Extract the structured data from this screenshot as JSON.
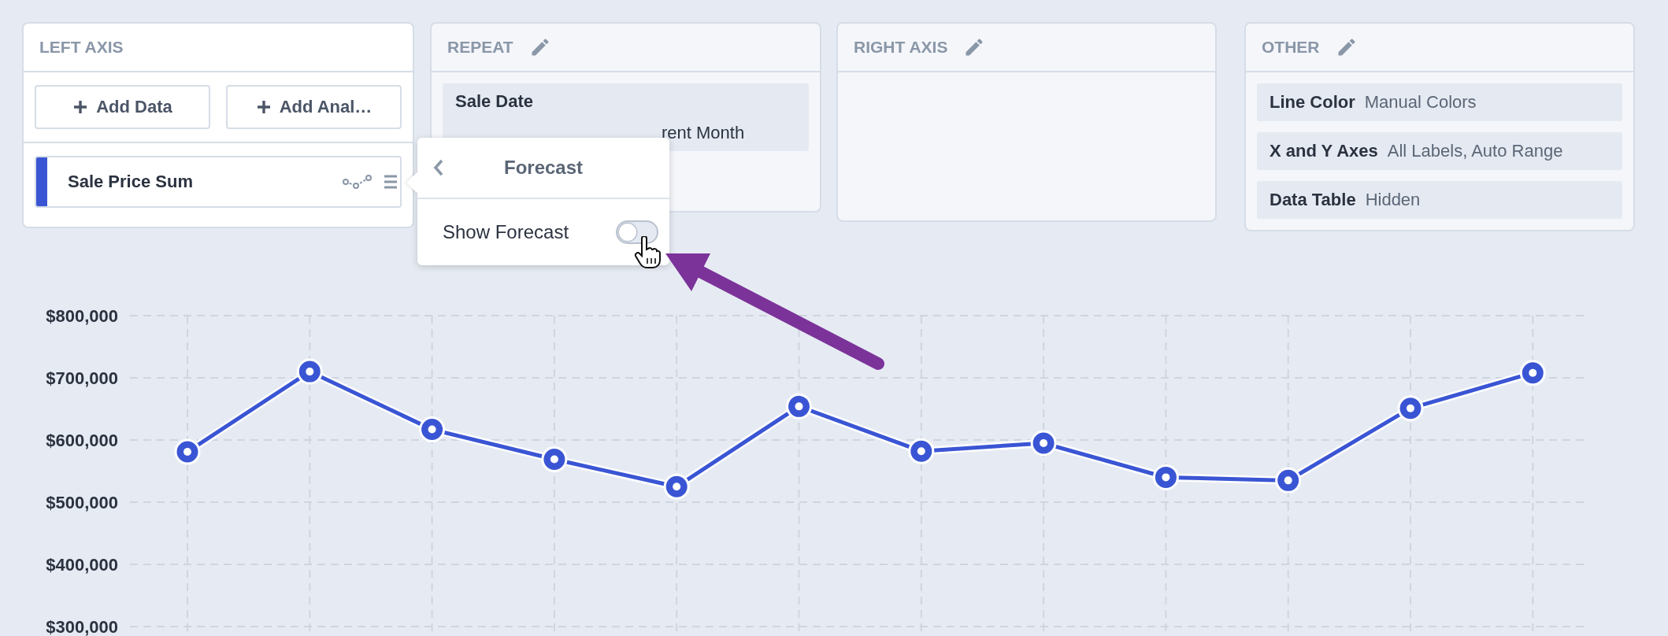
{
  "panels": [
    {
      "kind": "left_axis",
      "title": "LEFT AXIS",
      "editable": false,
      "buttons": [
        {
          "label": "Add Data"
        },
        {
          "label": "Add Anal…"
        }
      ]
    },
    {
      "kind": "repeat",
      "title": "REPEAT",
      "editable": true,
      "filters": [
        {
          "name": "Sale Date",
          "value": "rent Month"
        }
      ]
    },
    {
      "kind": "right_axis",
      "title": "RIGHT AXIS",
      "editable": true
    },
    {
      "kind": "other",
      "title": "OTHER",
      "editable": true,
      "settings": [
        {
          "name": "Line Color",
          "value": "Manual Colors"
        },
        {
          "name": "X and Y Axes",
          "value": "All Labels, Auto Range"
        },
        {
          "name": "Data Table",
          "value": "Hidden"
        }
      ]
    }
  ],
  "popover": {
    "title": "Forecast",
    "options": [
      {
        "label": "Show Forecast",
        "on": false
      }
    ]
  },
  "chart": {
    "chart_data": {
      "type": "line",
      "grid": true,
      "ylim": [
        300000,
        800000
      ],
      "yticks": [
        {
          "value": 300000,
          "label": "$300,000"
        },
        {
          "value": 400000,
          "label": "$400,000"
        },
        {
          "value": 500000,
          "label": "$500,000"
        },
        {
          "value": 600000,
          "label": "$600,000"
        },
        {
          "value": 700000,
          "label": "$700,000"
        },
        {
          "value": 800000,
          "label": "$800,000"
        }
      ],
      "series": [
        {
          "name": "Sale Price Sum",
          "color": "#3a55d4",
          "marker": true,
          "values": [
            581000,
            710000,
            617000,
            569000,
            525000,
            654000,
            582000,
            595000,
            540000,
            535000,
            651000,
            708000
          ]
        }
      ]
    }
  }
}
